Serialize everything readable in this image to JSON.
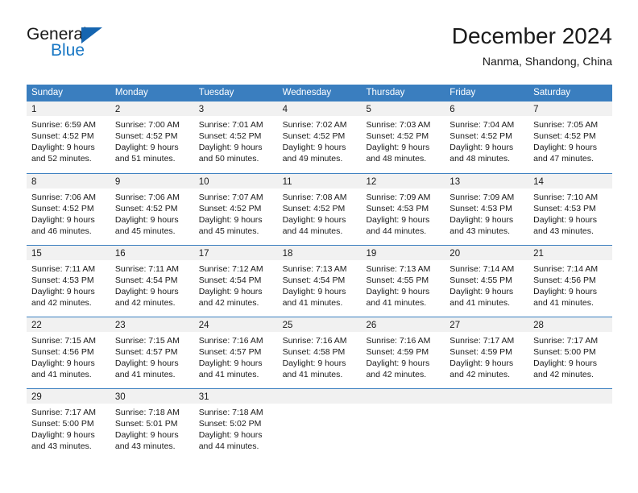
{
  "brand": {
    "name_part1": "General",
    "name_part2": "Blue",
    "accent_color": "#1877c4",
    "triangle_color": "#1565b0"
  },
  "header": {
    "title": "December 2024",
    "subtitle": "Nanma, Shandong, China"
  },
  "calendar": {
    "header_bg": "#3a7ebf",
    "daynumber_bg": "#f1f1f1",
    "weekdays": [
      "Sunday",
      "Monday",
      "Tuesday",
      "Wednesday",
      "Thursday",
      "Friday",
      "Saturday"
    ],
    "weeks": [
      [
        {
          "day": "1",
          "sunrise": "Sunrise: 6:59 AM",
          "sunset": "Sunset: 4:52 PM",
          "daylight": "Daylight: 9 hours and 52 minutes."
        },
        {
          "day": "2",
          "sunrise": "Sunrise: 7:00 AM",
          "sunset": "Sunset: 4:52 PM",
          "daylight": "Daylight: 9 hours and 51 minutes."
        },
        {
          "day": "3",
          "sunrise": "Sunrise: 7:01 AM",
          "sunset": "Sunset: 4:52 PM",
          "daylight": "Daylight: 9 hours and 50 minutes."
        },
        {
          "day": "4",
          "sunrise": "Sunrise: 7:02 AM",
          "sunset": "Sunset: 4:52 PM",
          "daylight": "Daylight: 9 hours and 49 minutes."
        },
        {
          "day": "5",
          "sunrise": "Sunrise: 7:03 AM",
          "sunset": "Sunset: 4:52 PM",
          "daylight": "Daylight: 9 hours and 48 minutes."
        },
        {
          "day": "6",
          "sunrise": "Sunrise: 7:04 AM",
          "sunset": "Sunset: 4:52 PM",
          "daylight": "Daylight: 9 hours and 48 minutes."
        },
        {
          "day": "7",
          "sunrise": "Sunrise: 7:05 AM",
          "sunset": "Sunset: 4:52 PM",
          "daylight": "Daylight: 9 hours and 47 minutes."
        }
      ],
      [
        {
          "day": "8",
          "sunrise": "Sunrise: 7:06 AM",
          "sunset": "Sunset: 4:52 PM",
          "daylight": "Daylight: 9 hours and 46 minutes."
        },
        {
          "day": "9",
          "sunrise": "Sunrise: 7:06 AM",
          "sunset": "Sunset: 4:52 PM",
          "daylight": "Daylight: 9 hours and 45 minutes."
        },
        {
          "day": "10",
          "sunrise": "Sunrise: 7:07 AM",
          "sunset": "Sunset: 4:52 PM",
          "daylight": "Daylight: 9 hours and 45 minutes."
        },
        {
          "day": "11",
          "sunrise": "Sunrise: 7:08 AM",
          "sunset": "Sunset: 4:52 PM",
          "daylight": "Daylight: 9 hours and 44 minutes."
        },
        {
          "day": "12",
          "sunrise": "Sunrise: 7:09 AM",
          "sunset": "Sunset: 4:53 PM",
          "daylight": "Daylight: 9 hours and 44 minutes."
        },
        {
          "day": "13",
          "sunrise": "Sunrise: 7:09 AM",
          "sunset": "Sunset: 4:53 PM",
          "daylight": "Daylight: 9 hours and 43 minutes."
        },
        {
          "day": "14",
          "sunrise": "Sunrise: 7:10 AM",
          "sunset": "Sunset: 4:53 PM",
          "daylight": "Daylight: 9 hours and 43 minutes."
        }
      ],
      [
        {
          "day": "15",
          "sunrise": "Sunrise: 7:11 AM",
          "sunset": "Sunset: 4:53 PM",
          "daylight": "Daylight: 9 hours and 42 minutes."
        },
        {
          "day": "16",
          "sunrise": "Sunrise: 7:11 AM",
          "sunset": "Sunset: 4:54 PM",
          "daylight": "Daylight: 9 hours and 42 minutes."
        },
        {
          "day": "17",
          "sunrise": "Sunrise: 7:12 AM",
          "sunset": "Sunset: 4:54 PM",
          "daylight": "Daylight: 9 hours and 42 minutes."
        },
        {
          "day": "18",
          "sunrise": "Sunrise: 7:13 AM",
          "sunset": "Sunset: 4:54 PM",
          "daylight": "Daylight: 9 hours and 41 minutes."
        },
        {
          "day": "19",
          "sunrise": "Sunrise: 7:13 AM",
          "sunset": "Sunset: 4:55 PM",
          "daylight": "Daylight: 9 hours and 41 minutes."
        },
        {
          "day": "20",
          "sunrise": "Sunrise: 7:14 AM",
          "sunset": "Sunset: 4:55 PM",
          "daylight": "Daylight: 9 hours and 41 minutes."
        },
        {
          "day": "21",
          "sunrise": "Sunrise: 7:14 AM",
          "sunset": "Sunset: 4:56 PM",
          "daylight": "Daylight: 9 hours and 41 minutes."
        }
      ],
      [
        {
          "day": "22",
          "sunrise": "Sunrise: 7:15 AM",
          "sunset": "Sunset: 4:56 PM",
          "daylight": "Daylight: 9 hours and 41 minutes."
        },
        {
          "day": "23",
          "sunrise": "Sunrise: 7:15 AM",
          "sunset": "Sunset: 4:57 PM",
          "daylight": "Daylight: 9 hours and 41 minutes."
        },
        {
          "day": "24",
          "sunrise": "Sunrise: 7:16 AM",
          "sunset": "Sunset: 4:57 PM",
          "daylight": "Daylight: 9 hours and 41 minutes."
        },
        {
          "day": "25",
          "sunrise": "Sunrise: 7:16 AM",
          "sunset": "Sunset: 4:58 PM",
          "daylight": "Daylight: 9 hours and 41 minutes."
        },
        {
          "day": "26",
          "sunrise": "Sunrise: 7:16 AM",
          "sunset": "Sunset: 4:59 PM",
          "daylight": "Daylight: 9 hours and 42 minutes."
        },
        {
          "day": "27",
          "sunrise": "Sunrise: 7:17 AM",
          "sunset": "Sunset: 4:59 PM",
          "daylight": "Daylight: 9 hours and 42 minutes."
        },
        {
          "day": "28",
          "sunrise": "Sunrise: 7:17 AM",
          "sunset": "Sunset: 5:00 PM",
          "daylight": "Daylight: 9 hours and 42 minutes."
        }
      ],
      [
        {
          "day": "29",
          "sunrise": "Sunrise: 7:17 AM",
          "sunset": "Sunset: 5:00 PM",
          "daylight": "Daylight: 9 hours and 43 minutes."
        },
        {
          "day": "30",
          "sunrise": "Sunrise: 7:18 AM",
          "sunset": "Sunset: 5:01 PM",
          "daylight": "Daylight: 9 hours and 43 minutes."
        },
        {
          "day": "31",
          "sunrise": "Sunrise: 7:18 AM",
          "sunset": "Sunset: 5:02 PM",
          "daylight": "Daylight: 9 hours and 44 minutes."
        },
        {
          "day": "",
          "sunrise": "",
          "sunset": "",
          "daylight": ""
        },
        {
          "day": "",
          "sunrise": "",
          "sunset": "",
          "daylight": ""
        },
        {
          "day": "",
          "sunrise": "",
          "sunset": "",
          "daylight": ""
        },
        {
          "day": "",
          "sunrise": "",
          "sunset": "",
          "daylight": ""
        }
      ]
    ]
  }
}
